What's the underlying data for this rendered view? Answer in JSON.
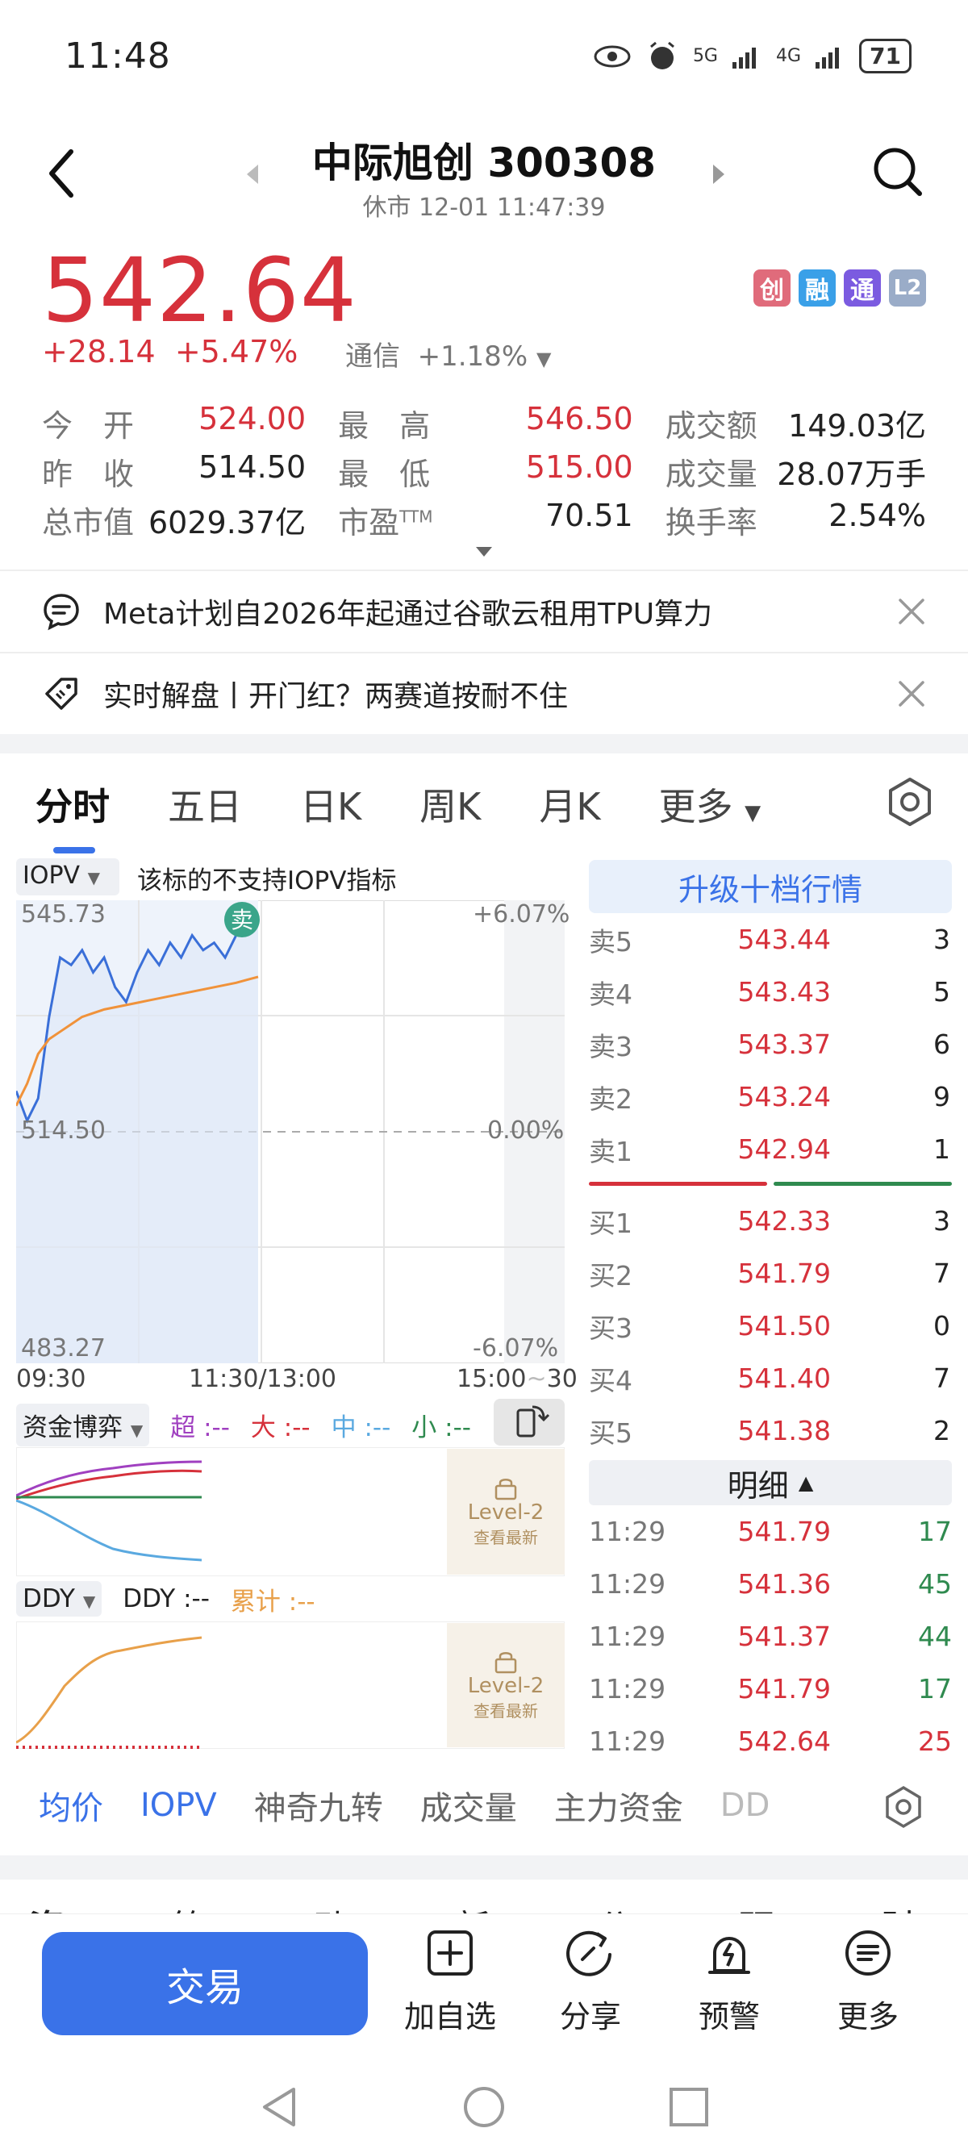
{
  "status_bar": {
    "time": "11:48",
    "net1": "5G",
    "net2": "4G",
    "battery": "71"
  },
  "header": {
    "title": "中际旭创 300308",
    "subtitle": "休市 12-01 11:47:39"
  },
  "quote": {
    "price": "542.64",
    "change": "+28.14",
    "change_pct": "+5.47%",
    "sector_name": "通信",
    "sector_pct": "+1.18%",
    "badges": [
      {
        "text": "创",
        "color": "#e06b7b"
      },
      {
        "text": "融",
        "color": "#3aa0e8"
      },
      {
        "text": "通",
        "color": "#7b5be0"
      },
      {
        "text": "L2",
        "color": "#9aacc8"
      }
    ]
  },
  "stats": {
    "row1": {
      "l1": "今　开",
      "v1": "524.00",
      "l2": "最　高",
      "v2": "546.50",
      "l3": "成交额",
      "v3": "149.03亿"
    },
    "row2": {
      "l1": "昨　收",
      "v1": "514.50",
      "l2": "最　低",
      "v2": "515.00",
      "l3": "成交量",
      "v3": "28.07万手"
    },
    "row3": {
      "l1": "总市值",
      "v1": "6029.37亿",
      "l2": "市盈",
      "l2_sup": "TTM",
      "v2": "70.51",
      "l3": "换手率",
      "v3": "2.54%"
    }
  },
  "news": [
    {
      "text": "Meta计划自2026年起通过谷歌云租用TPU算力"
    },
    {
      "text": "实时解盘丨开门红？两赛道按耐不住"
    }
  ],
  "tabs": [
    "分时",
    "五日",
    "日K",
    "周K",
    "月K",
    "更多"
  ],
  "chart": {
    "indicator_label": "IOPV",
    "indicator_note": "该标的不支持IOPV指标",
    "y_high": "545.73",
    "y_mid": "514.50",
    "y_low": "483.27",
    "pct_high": "+6.07%",
    "pct_mid": "0.00%",
    "pct_low": "-6.07%",
    "x_start": "09:30",
    "x_mid": "11:30/13:00",
    "x_end": "15:00",
    "x_extra": "30",
    "sell_marker": "卖"
  },
  "chart_data": {
    "type": "line",
    "title": "",
    "ylim": [
      483.27,
      545.73
    ],
    "x_labels": [
      "09:30",
      "11:30/13:00",
      "15:00"
    ],
    "series": [
      {
        "values": [
          520,
          516,
          519,
          530,
          538,
          537,
          539,
          536,
          538,
          534,
          532,
          536,
          539,
          537,
          540,
          538,
          541,
          539,
          540,
          538,
          541,
          543,
          542.6
        ]
      },
      {
        "values": [
          518,
          521,
          525,
          527,
          528,
          529,
          530,
          530.5,
          531,
          531.3,
          531.6,
          531.9,
          532.2,
          532.5,
          532.8,
          533.1,
          533.4,
          533.7,
          534,
          534.3,
          534.6,
          535,
          535.4
        ]
      }
    ]
  },
  "order_book": {
    "upgrade_label": "升级十档行情",
    "asks": [
      {
        "label": "卖5",
        "price": "543.44",
        "qty": "3"
      },
      {
        "label": "卖4",
        "price": "543.43",
        "qty": "5"
      },
      {
        "label": "卖3",
        "price": "543.37",
        "qty": "6"
      },
      {
        "label": "卖2",
        "price": "543.24",
        "qty": "9"
      },
      {
        "label": "卖1",
        "price": "542.94",
        "qty": "1"
      }
    ],
    "bids": [
      {
        "label": "买1",
        "price": "542.33",
        "qty": "3"
      },
      {
        "label": "买2",
        "price": "541.79",
        "qty": "7"
      },
      {
        "label": "买3",
        "price": "541.50",
        "qty": "0"
      },
      {
        "label": "买4",
        "price": "541.40",
        "qty": "7"
      },
      {
        "label": "买5",
        "price": "541.38",
        "qty": "2"
      }
    ],
    "detail_label": "明细",
    "details": [
      {
        "time": "11:29",
        "price": "541.79",
        "qty": "17",
        "dir": "green"
      },
      {
        "time": "11:29",
        "price": "541.36",
        "qty": "45",
        "dir": "green"
      },
      {
        "time": "11:29",
        "price": "541.37",
        "qty": "44",
        "dir": "green"
      },
      {
        "time": "11:29",
        "price": "541.79",
        "qty": "17",
        "dir": "green"
      },
      {
        "time": "11:29",
        "price": "542.64",
        "qty": "25",
        "dir": "red"
      }
    ]
  },
  "fund_panel": {
    "selector": "资金博弈",
    "super": "超 :--",
    "big": "大 :--",
    "mid": "中 :--",
    "small": "小 :--",
    "level2_title": "Level-2",
    "level2_sub": "查看最新"
  },
  "ddy_panel": {
    "selector": "DDY",
    "ddy": "DDY :--",
    "cum": "累计 :--",
    "level2_title": "Level-2",
    "level2_sub": "查看最新"
  },
  "indicator_tabs": [
    "均价",
    "IOPV",
    "神奇九转",
    "成交量",
    "主力资金",
    "DD"
  ],
  "bottom_bar": {
    "trade": "交易",
    "add": "加自选",
    "share": "分享",
    "alert": "预警",
    "more": "更多"
  },
  "partial_tabs": [
    "资金",
    "简况",
    "动态",
    "新闻",
    "公告",
    "研报",
    "财务"
  ]
}
